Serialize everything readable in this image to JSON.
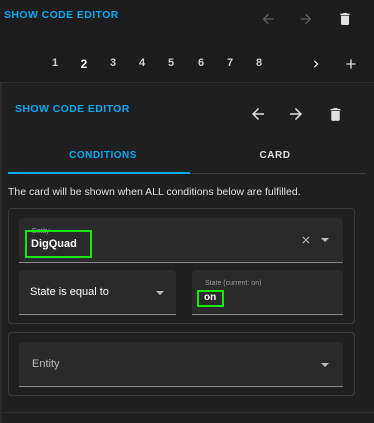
{
  "top_toolbar": {
    "show_code_editor": "SHOW CODE EDITOR",
    "icons": [
      "arrow-left-icon",
      "arrow-right-icon",
      "delete-icon"
    ]
  },
  "pagination": {
    "pages": [
      "1",
      "2",
      "3",
      "4",
      "5",
      "6",
      "7",
      "8"
    ],
    "active": "2",
    "icons": [
      "chevron-right-icon",
      "plus-icon"
    ]
  },
  "inner_toolbar": {
    "show_code_editor": "SHOW CODE EDITOR"
  },
  "tabs": {
    "conditions": "CONDITIONS",
    "card": "CARD",
    "active": "conditions"
  },
  "description": "The card will be shown when ALL conditions below are fulfilled.",
  "condition1": {
    "entity_label": "Entity",
    "entity_value": "DigQuad",
    "state_select": "State is equal to",
    "state_label": "State (current: on)",
    "state_value": "on"
  },
  "condition2": {
    "entity_placeholder": "Entity"
  },
  "colors": {
    "accent": "#03a9f4",
    "highlight": "#17e800",
    "background": "#1c1c1c"
  }
}
